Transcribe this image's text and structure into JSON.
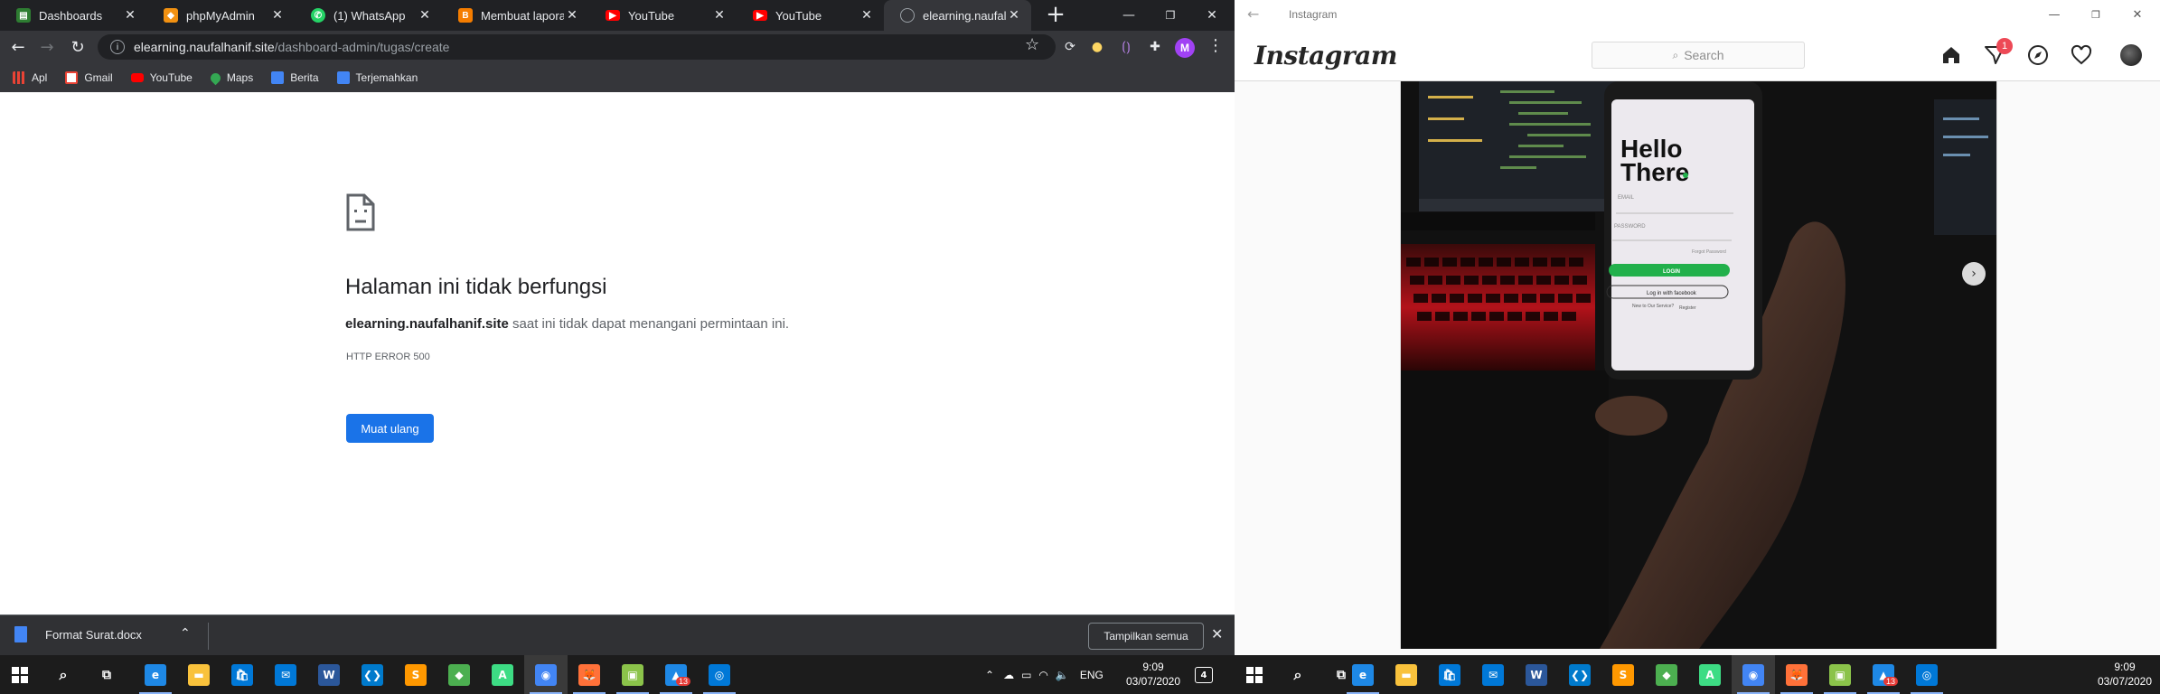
{
  "chrome": {
    "tabs": [
      {
        "label": "Dashboards",
        "icon": "dashboard-favicon",
        "color": "#2e7d32"
      },
      {
        "label": "phpMyAdmin",
        "icon": "phpmyadmin-favicon",
        "color": "#f29111"
      },
      {
        "label": "(1) WhatsApp",
        "icon": "whatsapp-favicon",
        "color": "#25d366"
      },
      {
        "label": "Membuat laporan",
        "icon": "blogger-favicon",
        "color": "#f57d00"
      },
      {
        "label": "YouTube",
        "icon": "youtube-favicon",
        "color": "#ff0000"
      },
      {
        "label": "YouTube",
        "icon": "youtube-favicon",
        "color": "#ff0000"
      },
      {
        "label": "elearning.naufalha",
        "icon": "globe-favicon",
        "color": "#9aa0a6",
        "active": true
      }
    ],
    "new_tab": "+",
    "address": {
      "host": "elearning.naufalhanif.site",
      "path": "/dashboard-admin/tugas/create"
    },
    "avatar_letter": "M",
    "bookmarks": [
      {
        "label": "Apl",
        "icon": "apps-grid-icon",
        "color": "#e8eaed"
      },
      {
        "label": "Gmail",
        "icon": "gmail-icon",
        "color": "#ea4335"
      },
      {
        "label": "YouTube",
        "icon": "youtube-icon",
        "color": "#ff0000"
      },
      {
        "label": "Maps",
        "icon": "maps-icon",
        "color": "#34a853"
      },
      {
        "label": "Berita",
        "icon": "news-icon",
        "color": "#4285f4"
      },
      {
        "label": "Terjemahkan",
        "icon": "translate-icon",
        "color": "#4285f4"
      }
    ],
    "error": {
      "title": "Halaman ini tidak berfungsi",
      "host_bold": "elearning.naufalhanif.site",
      "message_rest": " saat ini tidak dapat menangani permintaan ini.",
      "code": "HTTP ERROR 500",
      "reload_label": "Muat ulang"
    },
    "downloads": {
      "file": "Format Surat.docx",
      "show_all": "Tampilkan semua"
    }
  },
  "taskbar": {
    "language": "ENG",
    "time": "9:09",
    "date": "03/07/2020",
    "notification_count": "4",
    "badge_count": "13",
    "apps": [
      {
        "name": "edge-icon",
        "color": "#1e88e5"
      },
      {
        "name": "file-explorer-icon",
        "color": "#f9c23c"
      },
      {
        "name": "store-icon",
        "color": "#0078d7"
      },
      {
        "name": "mail-icon",
        "color": "#0078d7"
      },
      {
        "name": "word-icon",
        "color": "#2b579a"
      },
      {
        "name": "vscode-icon",
        "color": "#007acc"
      },
      {
        "name": "sublime-icon",
        "color": "#ff9800"
      },
      {
        "name": "git-icon",
        "color": "#4caf50"
      },
      {
        "name": "android-studio-icon",
        "color": "#3ddc84"
      },
      {
        "name": "chrome-icon",
        "color": "#4285f4"
      },
      {
        "name": "firefox-icon",
        "color": "#ff7139"
      },
      {
        "name": "terminal-icon",
        "color": "#8bc34a"
      },
      {
        "name": "steam-icon",
        "color": "#1e88e5"
      },
      {
        "name": "instagram-icon",
        "color": "#0078d7"
      }
    ]
  },
  "instagram": {
    "window_title": "Instagram",
    "logo": "Instagram",
    "search_placeholder": "Search",
    "notification_badge": "1",
    "photo_app": {
      "hello": "Hello",
      "there": "There",
      "email_label": "EMAIL",
      "password_label": "PASSWORD",
      "forgot": "Forgot Password",
      "login": "LOGIN",
      "facebook": "Log in with facebook",
      "new_prompt": "New to Our Service?",
      "register": "Register"
    }
  }
}
